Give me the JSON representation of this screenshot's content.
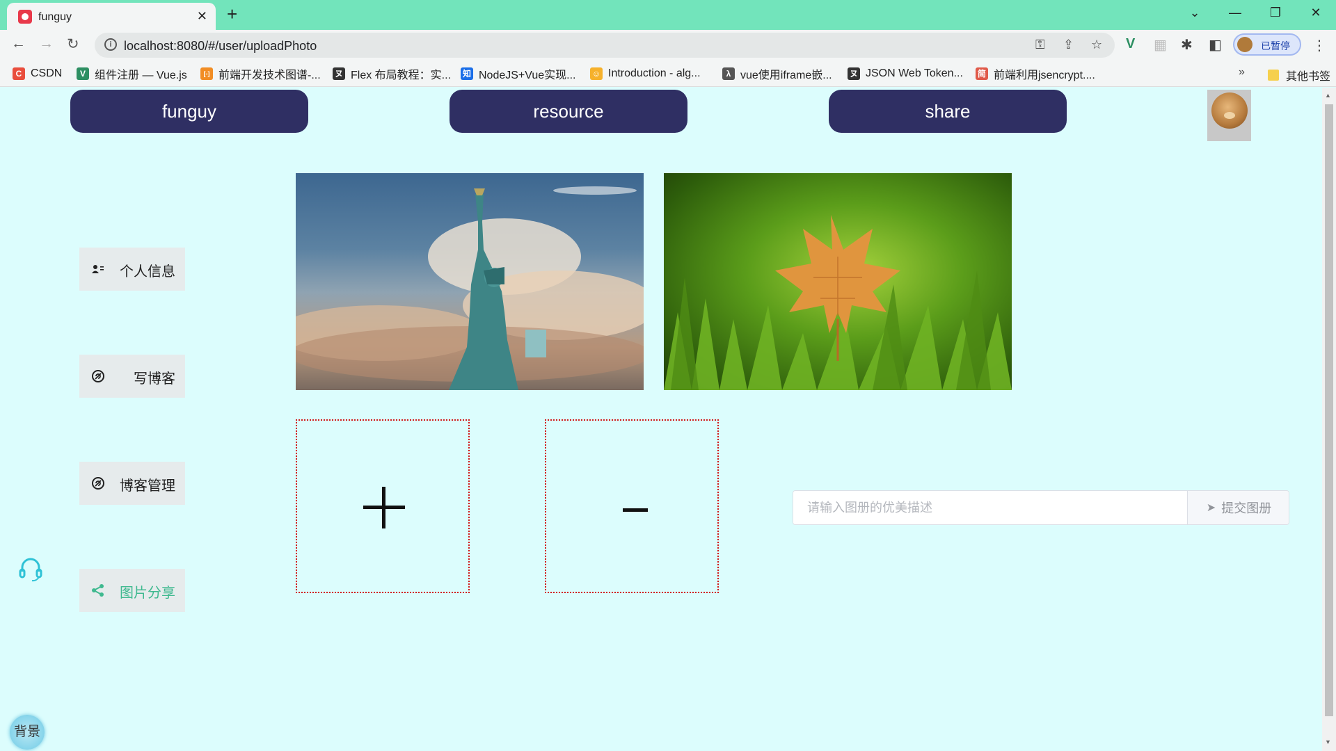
{
  "browser": {
    "tab_title": "funguy",
    "url": "localhost:8080/#/user/uploadPhoto",
    "profile_label": "已暂停",
    "bookmarks": [
      {
        "label": "CSDN",
        "icon": "C",
        "color": "#e94e3d"
      },
      {
        "label": "组件注册 — Vue.js",
        "icon": "V",
        "color": "#2d8f62"
      },
      {
        "label": "前端开发技术图谱-...",
        "icon": "[-]",
        "color": "#f18d24"
      },
      {
        "label": "Flex 布局教程：实...",
        "icon": "ヌ",
        "color": "#333333"
      },
      {
        "label": "NodeJS+Vue实现...",
        "icon": "知",
        "color": "#1a6ee8"
      },
      {
        "label": "Introduction - alg...",
        "icon": "☺",
        "color": "#f6b12b"
      },
      {
        "label": "vue使用iframe嵌...",
        "icon": "λ",
        "color": "#555555"
      },
      {
        "label": "JSON Web Token...",
        "icon": "ヌ",
        "color": "#333333"
      },
      {
        "label": "前端利用jsencrypt....",
        "icon": "简",
        "color": "#e05a4a"
      }
    ],
    "bookmarks_more": "»",
    "other_bookmarks": "其他书签"
  },
  "nav": {
    "items": [
      "funguy",
      "resource",
      "share"
    ]
  },
  "sidebar": {
    "items": [
      {
        "label": "个人信息",
        "icon": "user-card-icon"
      },
      {
        "label": "写博客",
        "icon": "swirl-icon"
      },
      {
        "label": "博客管理",
        "icon": "swirl-icon"
      },
      {
        "label": "图片分享",
        "icon": "share-icon",
        "active": true
      }
    ]
  },
  "gallery": {
    "photos": [
      {
        "name": "statue-of-liberty-photo"
      },
      {
        "name": "maple-leaf-photo"
      }
    ]
  },
  "upload": {
    "add_symbol": "+",
    "remove_symbol": "−"
  },
  "form": {
    "description_placeholder": "请输入图册的优美描述",
    "description_value": "",
    "submit_label": "提交图册"
  },
  "background_button": "背景",
  "colors": {
    "tab_bar": "#72e4bb",
    "page_bg": "#dcfdfd",
    "nav_button": "#2f2f63",
    "active_accent": "#3fb98f",
    "upload_border": "#d11a1a"
  }
}
